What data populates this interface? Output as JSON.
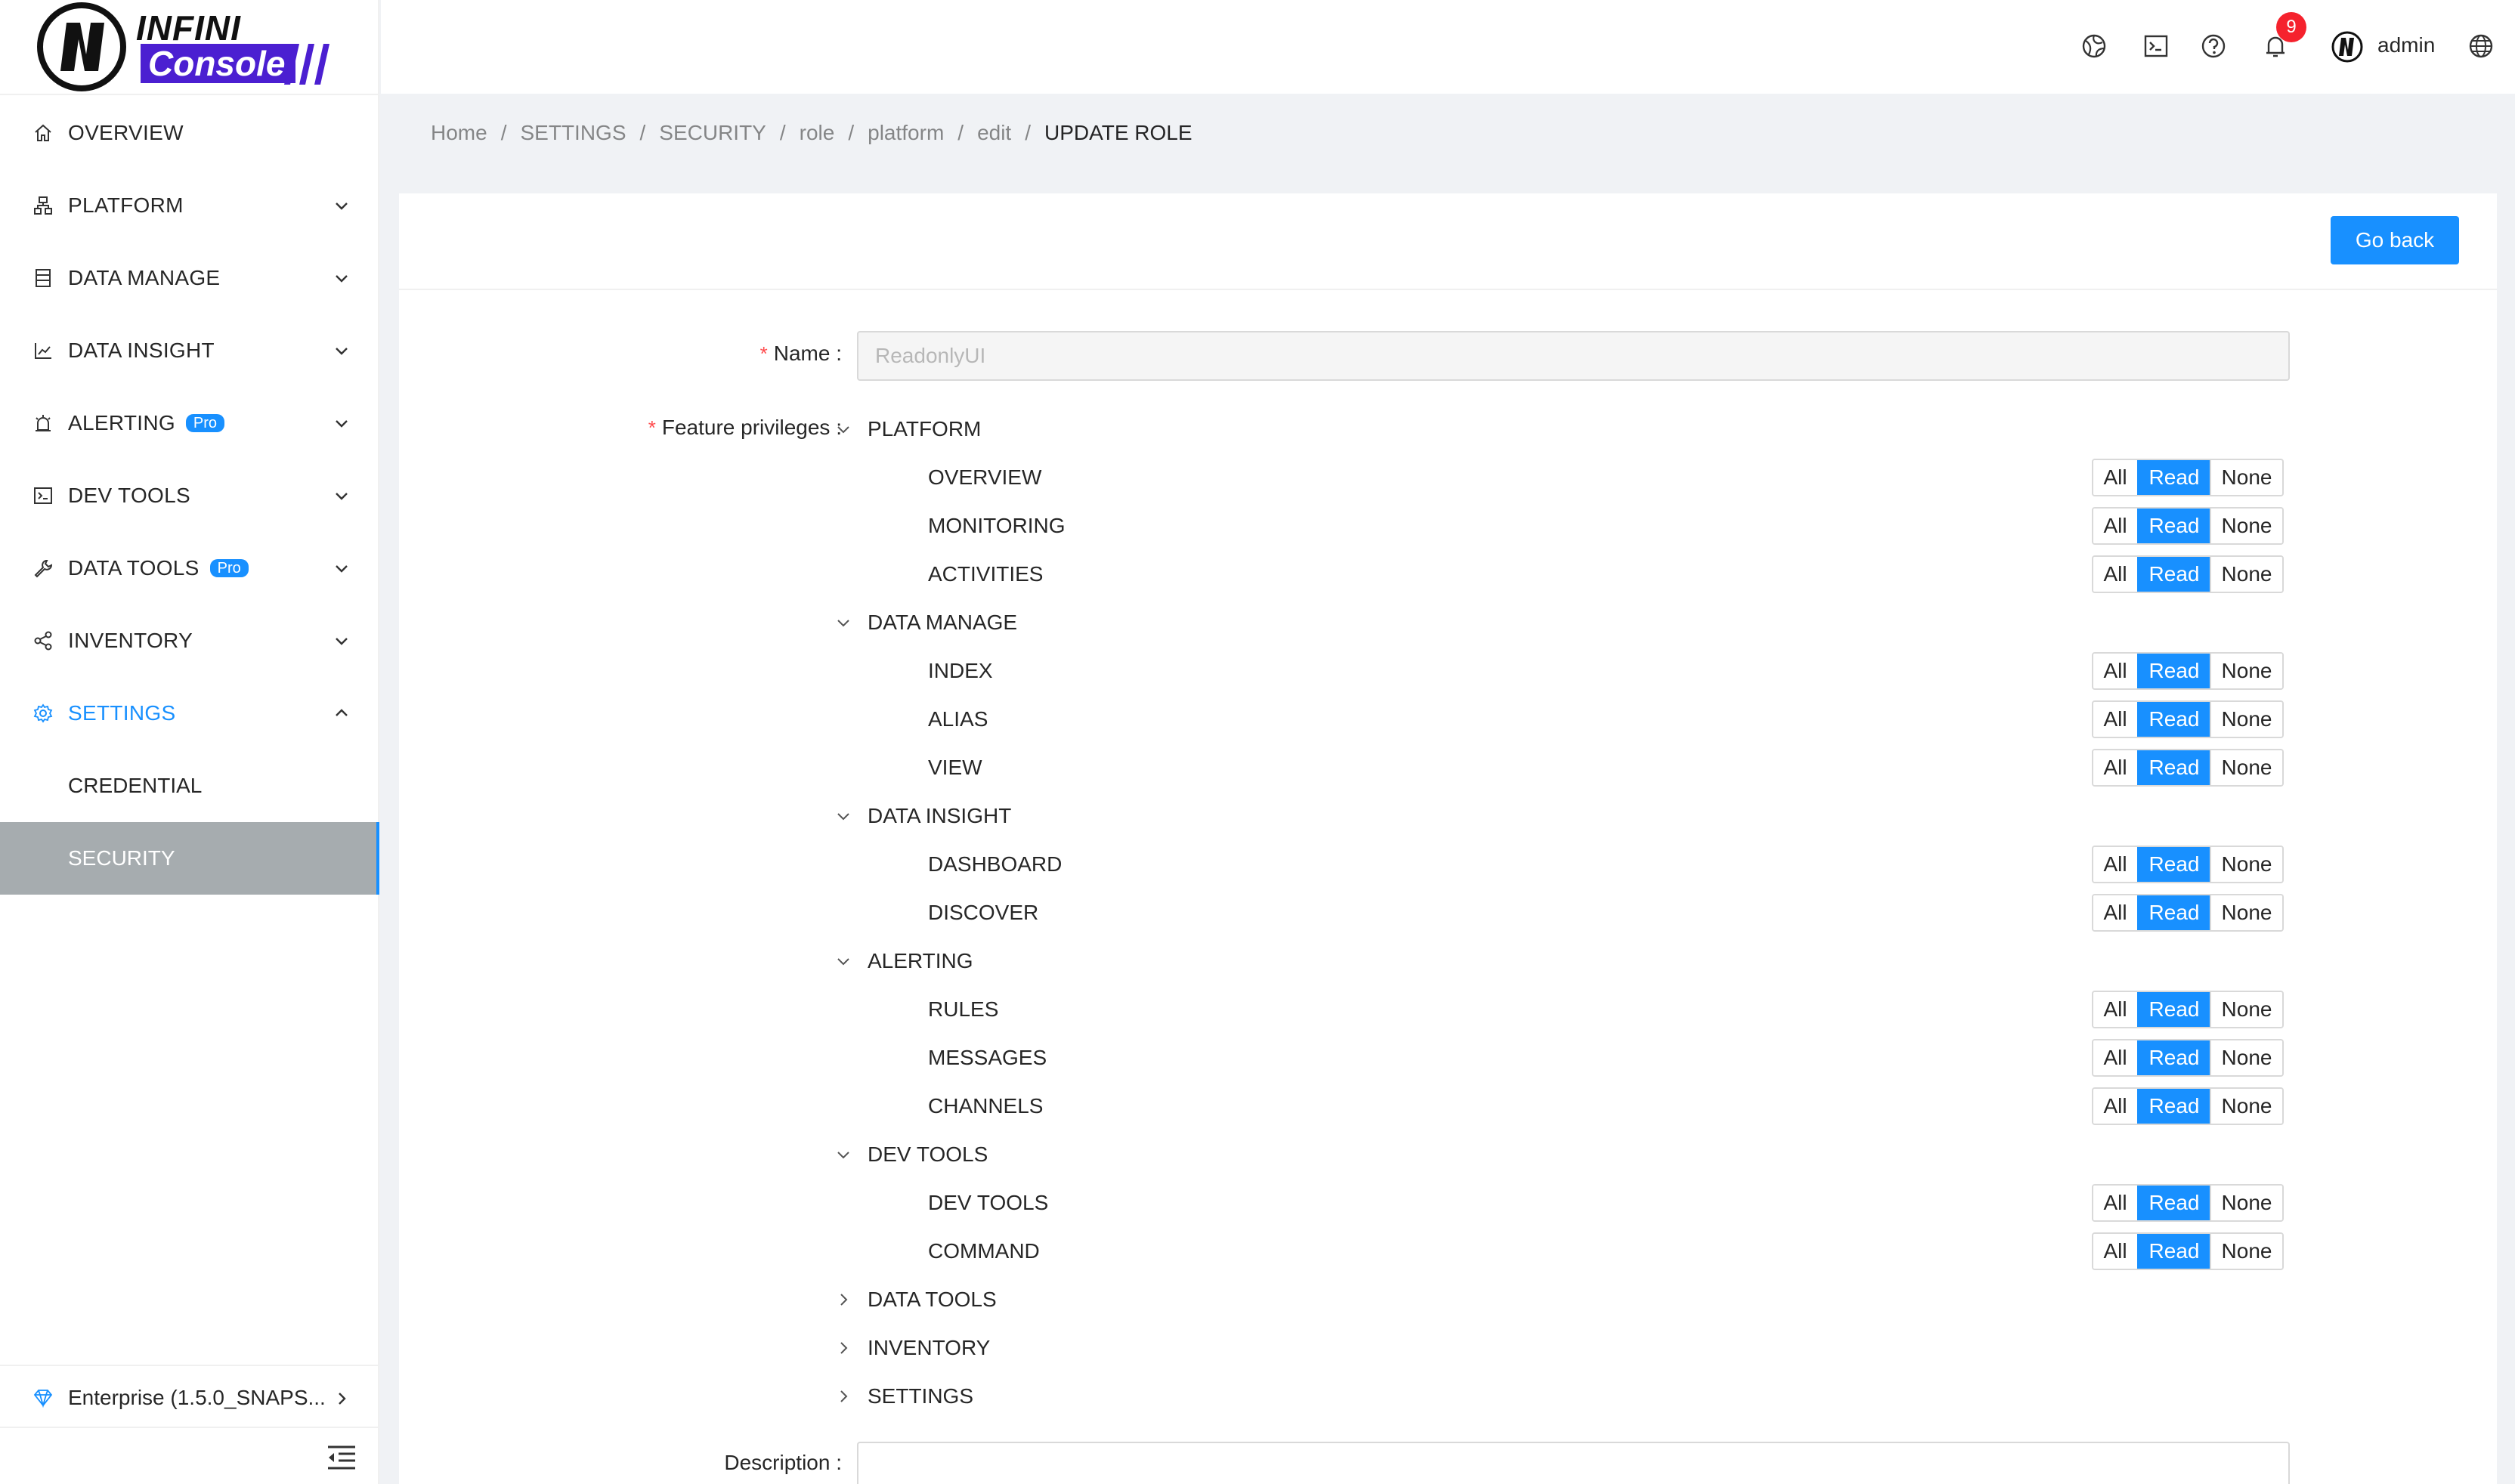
{
  "brand": {
    "line1": "INFINI",
    "line2": "Console"
  },
  "sidebar": {
    "items": [
      {
        "label": "OVERVIEW",
        "icon": "home-icon",
        "pro": "",
        "expandable": false
      },
      {
        "label": "PLATFORM",
        "icon": "cluster-icon",
        "pro": "",
        "expandable": true
      },
      {
        "label": "DATA MANAGE",
        "icon": "database-icon",
        "pro": "",
        "expandable": true
      },
      {
        "label": "DATA INSIGHT",
        "icon": "line-chart-icon",
        "pro": "",
        "expandable": true
      },
      {
        "label": "ALERTING",
        "icon": "alarm-icon",
        "pro": "Pro",
        "expandable": true
      },
      {
        "label": "DEV TOOLS",
        "icon": "terminal-icon",
        "pro": "",
        "expandable": true
      },
      {
        "label": "DATA TOOLS",
        "icon": "tool-icon",
        "pro": "Pro",
        "expandable": true
      },
      {
        "label": "INVENTORY",
        "icon": "share-icon",
        "pro": "",
        "expandable": true
      },
      {
        "label": "SETTINGS",
        "icon": "gear-icon",
        "pro": "",
        "expandable": true,
        "active": true
      }
    ],
    "settings_sub": [
      {
        "label": "CREDENTIAL",
        "selected": false
      },
      {
        "label": "SECURITY",
        "selected": true
      }
    ],
    "enterprise": "Enterprise (1.5.0_SNAPS..."
  },
  "header": {
    "notification_count": "9",
    "user": "admin"
  },
  "breadcrumb": [
    "Home",
    "SETTINGS",
    "SECURITY",
    "role",
    "platform",
    "edit",
    "UPDATE ROLE"
  ],
  "card": {
    "go_back": "Go back",
    "name_label": "Name",
    "name_value": "ReadonlyUI",
    "privileges_label": "Feature privileges",
    "description_label": "Description",
    "privilege_options": [
      "All",
      "Read",
      "None"
    ],
    "groups": [
      {
        "label": "PLATFORM",
        "expanded": true,
        "children": [
          {
            "label": "OVERVIEW",
            "value": "Read"
          },
          {
            "label": "MONITORING",
            "value": "Read"
          },
          {
            "label": "ACTIVITIES",
            "value": "Read"
          }
        ]
      },
      {
        "label": "DATA MANAGE",
        "expanded": true,
        "children": [
          {
            "label": "INDEX",
            "value": "Read"
          },
          {
            "label": "ALIAS",
            "value": "Read"
          },
          {
            "label": "VIEW",
            "value": "Read"
          }
        ]
      },
      {
        "label": "DATA INSIGHT",
        "expanded": true,
        "children": [
          {
            "label": "DASHBOARD",
            "value": "Read"
          },
          {
            "label": "DISCOVER",
            "value": "Read"
          }
        ]
      },
      {
        "label": "ALERTING",
        "expanded": true,
        "children": [
          {
            "label": "RULES",
            "value": "Read"
          },
          {
            "label": "MESSAGES",
            "value": "Read"
          },
          {
            "label": "CHANNELS",
            "value": "Read"
          }
        ]
      },
      {
        "label": "DEV TOOLS",
        "expanded": true,
        "children": [
          {
            "label": "DEV TOOLS",
            "value": "Read"
          },
          {
            "label": "COMMAND",
            "value": "Read"
          }
        ]
      },
      {
        "label": "DATA TOOLS",
        "expanded": false,
        "children": []
      },
      {
        "label": "INVENTORY",
        "expanded": false,
        "children": []
      },
      {
        "label": "SETTINGS",
        "expanded": false,
        "children": []
      }
    ]
  },
  "colors": {
    "primary": "#1890ff",
    "required": "#ff4d4f",
    "brand_purple": "#4b1fd1",
    "selected_bg": "#a6acaf"
  }
}
